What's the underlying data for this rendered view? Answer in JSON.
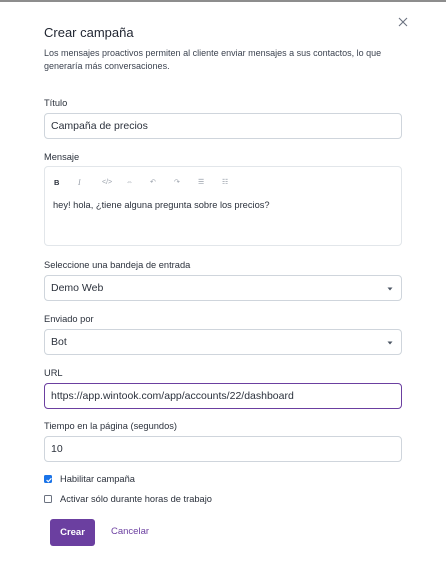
{
  "modal": {
    "title": "Crear campaña",
    "description": "Los mensajes proactivos permiten al cliente enviar mensajes a sus contactos, lo que generaría más conversaciones.",
    "close_icon": "close-icon"
  },
  "form": {
    "title_label": "Título",
    "title_value": "Campaña de precios",
    "message_label": "Mensaje",
    "message_value": "hey! hola, ¿tiene alguna pregunta sobre los precios?",
    "toolbar": {
      "bold": "B",
      "italic": "I",
      "code": "</>",
      "link": "⇔",
      "undo": "↶",
      "redo": "↷",
      "bullet_list": "☰",
      "ordered_list": "☷"
    },
    "inbox_label": "Seleccione una bandeja de entrada",
    "inbox_value": "Demo Web",
    "sender_label": "Enviado por",
    "sender_value": "Bot",
    "url_label": "URL",
    "url_value": "https://app.wintook.com/app/accounts/22/dashboard",
    "time_label": "Tiempo en la página (segundos)",
    "time_value": "10",
    "enable_campaign_label": "Habilitar campaña",
    "enable_campaign_checked": true,
    "business_hours_label": "Activar sólo durante horas de trabajo",
    "business_hours_checked": false
  },
  "actions": {
    "create_label": "Crear",
    "cancel_label": "Cancelar"
  },
  "colors": {
    "accent": "#6b3fa0",
    "checkbox_checked": "#1a73e8",
    "border": "#cfd5dc"
  }
}
